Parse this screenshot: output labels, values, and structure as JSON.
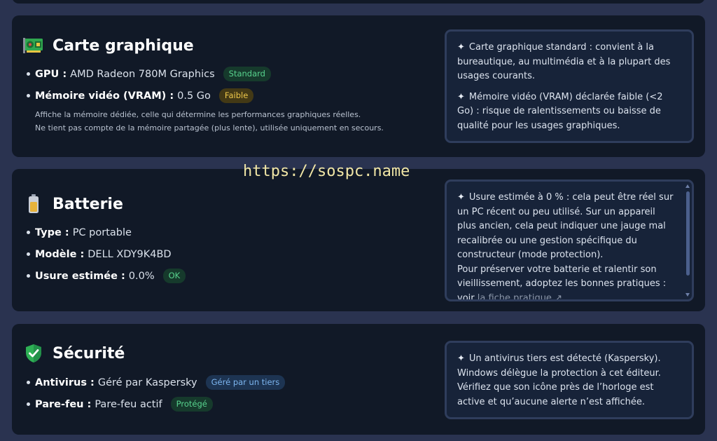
{
  "watermark": "https://sospc.name",
  "gpu_card": {
    "title": "Carte graphique",
    "icon": "graphics-card-icon",
    "items": [
      {
        "label": "GPU :",
        "value": "AMD Radeon 780M Graphics",
        "badge": "Standard",
        "badge_color": "green"
      },
      {
        "label": "Mémoire vidéo (VRAM) :",
        "value": "0.5 Go",
        "badge": "Faible",
        "badge_color": "yellow"
      }
    ],
    "note_line1": "Affiche la mémoire dédiée, celle qui détermine les performances graphiques réelles.",
    "note_line2": "Ne tient pas compte de la mémoire partagée (plus lente), utilisée uniquement en secours.",
    "info": [
      "Carte graphique standard : convient à la bureautique, au multimédia et à la plupart des usages courants.",
      "Mémoire vidéo (VRAM) déclarée faible (<2 Go) : risque de ralentissements ou baisse de qualité pour les usages graphiques."
    ]
  },
  "battery_card": {
    "title": "Batterie",
    "icon": "battery-icon",
    "items": [
      {
        "label": "Type :",
        "value": "PC portable"
      },
      {
        "label": "Modèle :",
        "value": "DELL XDY9K4BD"
      },
      {
        "label": "Usure estimée :",
        "value": "0.0%",
        "badge": "OK",
        "badge_color": "green"
      }
    ],
    "info_text1": "Usure estimée à 0 % : cela peut être réel sur un PC récent ou peu utilisé. Sur un appareil plus ancien, cela peut indiquer une jauge mal recalibrée ou une gestion spécifique du constructeur (mode protection).",
    "info_text2": "Pour préserver votre batterie et ralentir son vieillissement, adoptez les bonnes pratiques : voir",
    "info_link": "la fiche pratique",
    "info_link_icon": "↗"
  },
  "security_card": {
    "title": "Sécurité",
    "icon": "shield-check-icon",
    "items": [
      {
        "label": "Antivirus :",
        "value": "Géré par Kaspersky",
        "badge": "Géré par un tiers",
        "badge_color": "blue"
      },
      {
        "label": "Pare-feu :",
        "value": "Pare-feu actif",
        "badge": "Protégé",
        "badge_color": "green"
      }
    ],
    "info": "Un antivirus tiers est détecté (Kaspersky). Windows délègue la protection à cet éditeur. Vérifiez que son icône près de l’horloge est active et qu’aucune alerte n’est affichée."
  },
  "colors": {
    "background": "#2a3350",
    "card": "#111927",
    "info_box": "#172339",
    "badge_green": "#58d38e",
    "badge_yellow": "#efc84a",
    "badge_blue": "#7cb5ef"
  }
}
